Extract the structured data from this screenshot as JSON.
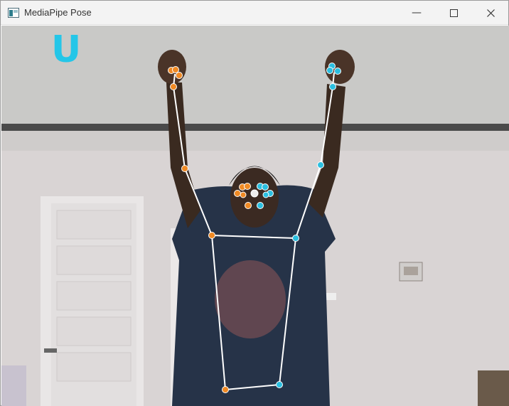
{
  "window": {
    "title": "MediaPipe Pose",
    "app_icon": "window-app-icon",
    "controls": {
      "minimize_icon": "minimize-icon",
      "maximize_icon": "maximize-icon",
      "close_icon": "close-icon"
    }
  },
  "overlay": {
    "gesture_label": "U",
    "label_color": "#24c6e8",
    "left_keypoint_color": "#f08a24",
    "right_keypoint_color": "#2bbfe0",
    "nose_color": "#ededed",
    "skeleton_color": "#ffffff"
  }
}
